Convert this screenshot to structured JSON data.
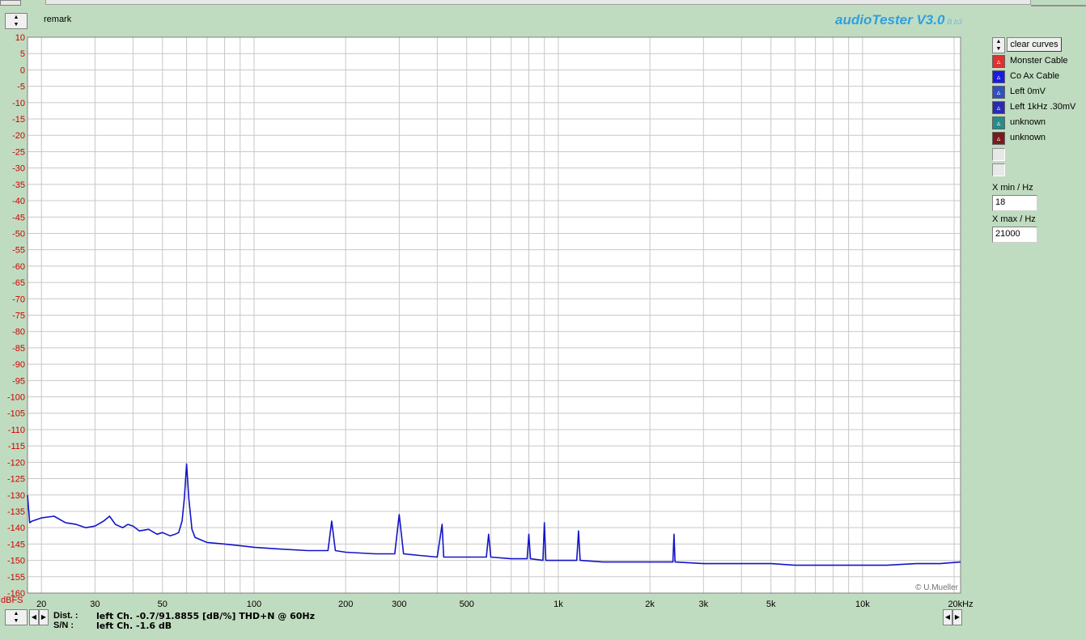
{
  "header": {
    "remark": "remark",
    "app_title": "audioTester V3.0",
    "app_version": "B b3"
  },
  "controls": {
    "clear_curves": "clear curves",
    "x_min_label": "X min / Hz",
    "x_min_value": "18",
    "x_max_label": "X max / Hz",
    "x_max_value": "21000"
  },
  "legend": [
    {
      "name": "Monster Cable",
      "color": "#e03030"
    },
    {
      "name": "Co Ax Cable",
      "color": "#1a1ae0"
    },
    {
      "name": "Left 0mV",
      "color": "#3050c0"
    },
    {
      "name": "Left 1kHz .30mV",
      "color": "#2a2ab0"
    },
    {
      "name": "unknown",
      "color": "#2a8a8a"
    },
    {
      "name": "unknown",
      "color": "#7a1a1a"
    }
  ],
  "status": {
    "dist_label": "Dist. :",
    "dist_value": "left Ch. -0.7/91.8855 [dB/%] THD+N  @ 60Hz",
    "sn_label": "S/N :",
    "sn_value": "left Ch. -1.6 dB"
  },
  "chart_data": {
    "type": "line",
    "ylabel": "dBFS",
    "xscale": "log",
    "xlim": [
      18,
      21000
    ],
    "ylim": [
      -160,
      10
    ],
    "grid": true,
    "y_ticks": [
      10,
      5,
      0,
      -5,
      -10,
      -15,
      -20,
      -25,
      -30,
      -35,
      -40,
      -45,
      -50,
      -55,
      -60,
      -65,
      -70,
      -75,
      -80,
      -85,
      -90,
      -95,
      -100,
      -105,
      -110,
      -115,
      -120,
      -125,
      -130,
      -135,
      -140,
      -145,
      -150,
      -155,
      -160
    ],
    "x_ticks": [
      20,
      30,
      50,
      100,
      200,
      300,
      500,
      1000,
      2000,
      3000,
      5000,
      10000,
      20000
    ],
    "x_tick_labels": [
      "20",
      "30",
      "50",
      "100",
      "200",
      "300",
      "500",
      "1k",
      "2k",
      "3k",
      "5k",
      "10k",
      "20kHz"
    ],
    "copyright": "© U.Mueller",
    "series": [
      {
        "color": "#1414c8",
        "x": [
          18,
          18.3,
          18.6,
          20,
          22,
          24,
          26,
          28,
          30,
          32,
          33.5,
          35,
          37,
          38.5,
          40,
          42,
          45,
          48,
          50,
          53,
          55,
          56.5,
          58,
          59,
          60,
          61,
          62.5,
          64,
          70,
          80,
          90,
          100,
          120,
          150,
          175,
          180,
          185,
          200,
          250,
          290,
          300,
          310,
          350,
          400,
          415,
          420,
          425,
          500,
          580,
          590,
          600,
          700,
          790,
          800,
          810,
          890,
          900,
          910,
          1000,
          1150,
          1165,
          1180,
          1400,
          1500,
          1600,
          2000,
          2380,
          2400,
          2420,
          3000,
          4000,
          5000,
          6000,
          8000,
          10000,
          12000,
          15000,
          18000,
          21000
        ],
        "y": [
          -130,
          -138.5,
          -138,
          -137,
          -136.5,
          -138.5,
          -139,
          -140,
          -139.5,
          -138,
          -136.5,
          -139,
          -140,
          -139,
          -139.5,
          -141,
          -140.5,
          -142,
          -141.5,
          -142.5,
          -142,
          -141.5,
          -138,
          -131,
          -120.5,
          -131,
          -140.5,
          -143,
          -144.5,
          -145,
          -145.5,
          -146,
          -146.5,
          -147,
          -147,
          -138,
          -147,
          -147.5,
          -148,
          -148,
          -136,
          -148,
          -148.5,
          -149,
          -139,
          -149,
          -149,
          -149,
          -149,
          -142,
          -149,
          -149.5,
          -149.5,
          -142,
          -149.5,
          -150,
          -138.5,
          -150,
          -150,
          -150,
          -141,
          -150,
          -150.5,
          -150.5,
          -150.5,
          -150.5,
          -150.5,
          -142,
          -150.5,
          -151,
          -151,
          -151,
          -151.5,
          -151.5,
          -151.5,
          -151.5,
          -151,
          -151,
          -150.5
        ]
      }
    ]
  }
}
